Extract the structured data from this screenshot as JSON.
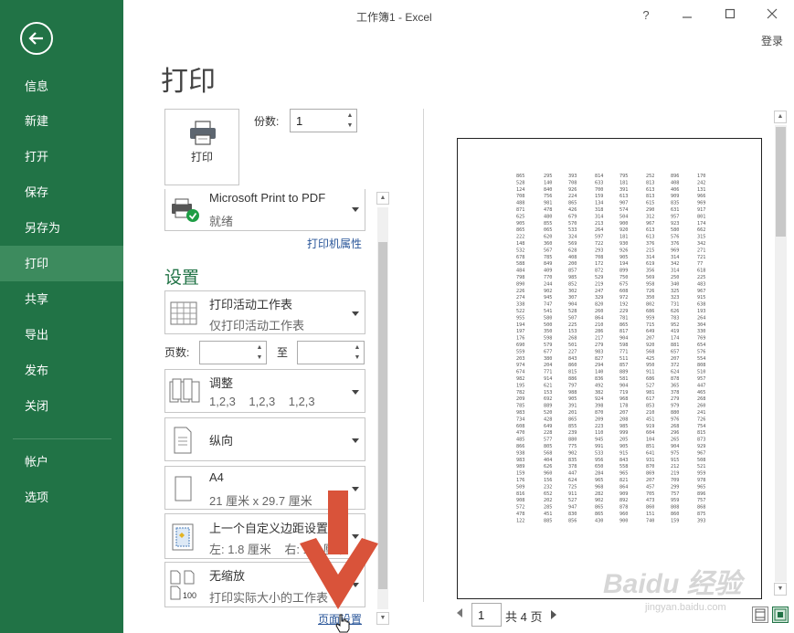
{
  "window": {
    "title": "工作簿1 - Excel",
    "help": "?",
    "login": "登录"
  },
  "sidebar": {
    "items": [
      {
        "label": "信息"
      },
      {
        "label": "新建"
      },
      {
        "label": "打开"
      },
      {
        "label": "保存"
      },
      {
        "label": "另存为"
      },
      {
        "label": "打印"
      },
      {
        "label": "共享"
      },
      {
        "label": "导出"
      },
      {
        "label": "发布"
      },
      {
        "label": "关闭"
      },
      {
        "label": "帐户"
      },
      {
        "label": "选项"
      }
    ],
    "active": "打印"
  },
  "page": {
    "title": "打印"
  },
  "print_button": {
    "label": "打印"
  },
  "copies": {
    "label": "份数:",
    "value": "1"
  },
  "printer": {
    "name": "Microsoft Print to PDF",
    "status": "就绪",
    "properties_link": "打印机属性"
  },
  "settings": {
    "heading": "设置",
    "what": {
      "title": "打印活动工作表",
      "subtitle": "仅打印活动工作表"
    },
    "pages": {
      "label": "页数:",
      "to_label": "至"
    },
    "collate": {
      "title": "调整",
      "subtitle": "1,2,3    1,2,3    1,2,3"
    },
    "orientation": {
      "title": "纵向"
    },
    "paper": {
      "title": "A4",
      "subtitle": "21 厘米 x 29.7 厘米"
    },
    "margins": {
      "title": "上一个自定义边距设置",
      "subtitle": "左: 1.8 厘米    右: 1.8 厘米"
    },
    "scaling": {
      "title": "无缩放",
      "subtitle": "打印实际大小的工作表"
    },
    "page_setup_link": "页面设置"
  },
  "preview": {
    "columns": 9,
    "rows": 60,
    "data_rows": [
      [
        "865",
        "295",
        "393",
        "814",
        "795",
        "252",
        "896",
        "170"
      ],
      [
        "528",
        "140",
        "708",
        "633",
        "181",
        "813",
        "408",
        "242"
      ],
      [
        "124",
        "840",
        "926",
        "700",
        "391",
        "613",
        "406",
        "131"
      ],
      [
        "708",
        "756",
        "224",
        "159",
        "613",
        "813",
        "909",
        "966"
      ],
      [
        "488",
        "981",
        "865",
        "134",
        "907",
        "615",
        "835",
        "969"
      ],
      [
        "871",
        "478",
        "426",
        "318",
        "574",
        "290",
        "631",
        "917"
      ],
      [
        "625",
        "480",
        "679",
        "314",
        "504",
        "312",
        "957",
        "801"
      ],
      [
        "905",
        "855",
        "570",
        "213",
        "900",
        "967",
        "923",
        "174"
      ],
      [
        "865",
        "065",
        "533",
        "264",
        "920",
        "613",
        "580",
        "662"
      ],
      [
        "222",
        "620",
        "324",
        "597",
        "181",
        "613",
        "576",
        "315"
      ],
      [
        "148",
        "360",
        "569",
        "722",
        "930",
        "376",
        "376",
        "342"
      ],
      [
        "532",
        "567",
        "628",
        "293",
        "926",
        "215",
        "969",
        "271"
      ],
      [
        "678",
        "785",
        "408",
        "708",
        "905",
        "314",
        "314",
        "721"
      ],
      [
        "588",
        "849",
        "200",
        "172",
        "194",
        "619",
        "342",
        "77"
      ],
      [
        "484",
        "409",
        "857",
        "872",
        "899",
        "356",
        "314",
        "618"
      ],
      [
        "798",
        "770",
        "985",
        "529",
        "750",
        "569",
        "250",
        "225"
      ],
      [
        "890",
        "244",
        "852",
        "219",
        "675",
        "958",
        "340",
        "483"
      ],
      [
        "226",
        "902",
        "302",
        "247",
        "608",
        "726",
        "325",
        "967"
      ],
      [
        "274",
        "945",
        "307",
        "329",
        "972",
        "350",
        "323",
        "915"
      ],
      [
        "338",
        "747",
        "904",
        "820",
        "192",
        "802",
        "731",
        "638"
      ],
      [
        "522",
        "541",
        "528",
        "260",
        "229",
        "686",
        "626",
        "193"
      ],
      [
        "955",
        "580",
        "507",
        "864",
        "781",
        "959",
        "783",
        "264"
      ],
      [
        "194",
        "500",
        "225",
        "210",
        "865",
        "715",
        "952",
        "304"
      ],
      [
        "197",
        "350",
        "153",
        "286",
        "817",
        "649",
        "419",
        "330"
      ],
      [
        "176",
        "598",
        "268",
        "217",
        "904",
        "207",
        "174",
        "769"
      ],
      [
        "690",
        "579",
        "501",
        "279",
        "598",
        "920",
        "881",
        "654"
      ],
      [
        "559",
        "677",
        "227",
        "983",
        "771",
        "568",
        "657",
        "576"
      ],
      [
        "203",
        "380",
        "843",
        "827",
        "511",
        "425",
        "207",
        "554"
      ],
      [
        "974",
        "204",
        "860",
        "294",
        "857",
        "950",
        "372",
        "808"
      ],
      [
        "674",
        "771",
        "815",
        "140",
        "889",
        "911",
        "624",
        "510"
      ],
      [
        "982",
        "914",
        "886",
        "836",
        "581",
        "686",
        "878",
        "957"
      ],
      [
        "195",
        "621",
        "797",
        "492",
        "904",
        "527",
        "365",
        "447"
      ],
      [
        "782",
        "153",
        "988",
        "382",
        "719",
        "981",
        "378",
        "465"
      ],
      [
        "209",
        "692",
        "905",
        "924",
        "968",
        "617",
        "279",
        "268"
      ],
      [
        "785",
        "889",
        "391",
        "398",
        "178",
        "853",
        "979",
        "260"
      ],
      [
        "983",
        "520",
        "201",
        "870",
        "207",
        "210",
        "880",
        "241"
      ],
      [
        "734",
        "428",
        "865",
        "209",
        "208",
        "451",
        "976",
        "726"
      ],
      [
        "608",
        "649",
        "855",
        "223",
        "985",
        "919",
        "268",
        "754"
      ],
      [
        "470",
        "228",
        "239",
        "110",
        "999",
        "604",
        "296",
        "815"
      ],
      [
        "485",
        "577",
        "880",
        "945",
        "205",
        "104",
        "265",
        "873"
      ],
      [
        "866",
        "805",
        "775",
        "991",
        "905",
        "851",
        "904",
        "929"
      ],
      [
        "938",
        "568",
        "902",
        "533",
        "915",
        "641",
        "975",
        "967"
      ],
      [
        "983",
        "404",
        "835",
        "956",
        "843",
        "931",
        "915",
        "508"
      ],
      [
        "989",
        "626",
        "378",
        "650",
        "558",
        "870",
        "212",
        "521"
      ],
      [
        "159",
        "960",
        "447",
        "284",
        "965",
        "869",
        "219",
        "959"
      ],
      [
        "176",
        "156",
        "624",
        "965",
        "821",
        "207",
        "709",
        "978"
      ],
      [
        "509",
        "232",
        "725",
        "968",
        "864",
        "457",
        "299",
        "965"
      ],
      [
        "816",
        "652",
        "911",
        "282",
        "909",
        "705",
        "757",
        "896"
      ],
      [
        "908",
        "202",
        "527",
        "902",
        "892",
        "473",
        "959",
        "757"
      ],
      [
        "572",
        "285",
        "947",
        "865",
        "878",
        "860",
        "808",
        "868"
      ],
      [
        "478",
        "451",
        "830",
        "865",
        "960",
        "151",
        "860",
        "875"
      ],
      [
        "122",
        "885",
        "856",
        "430",
        "900",
        "740",
        "159",
        "393"
      ]
    ]
  },
  "navigation": {
    "current_page": "1",
    "total_label": "共 4 页"
  },
  "watermark": {
    "text": "Baidu 经验",
    "sub": "jingyan.baidu.com"
  },
  "colors": {
    "sidebar": "#217346",
    "sidebar_active": "#3d8b5e",
    "accent_text": "#217346",
    "link": "#2b579a",
    "arrow": "#d9533a"
  }
}
